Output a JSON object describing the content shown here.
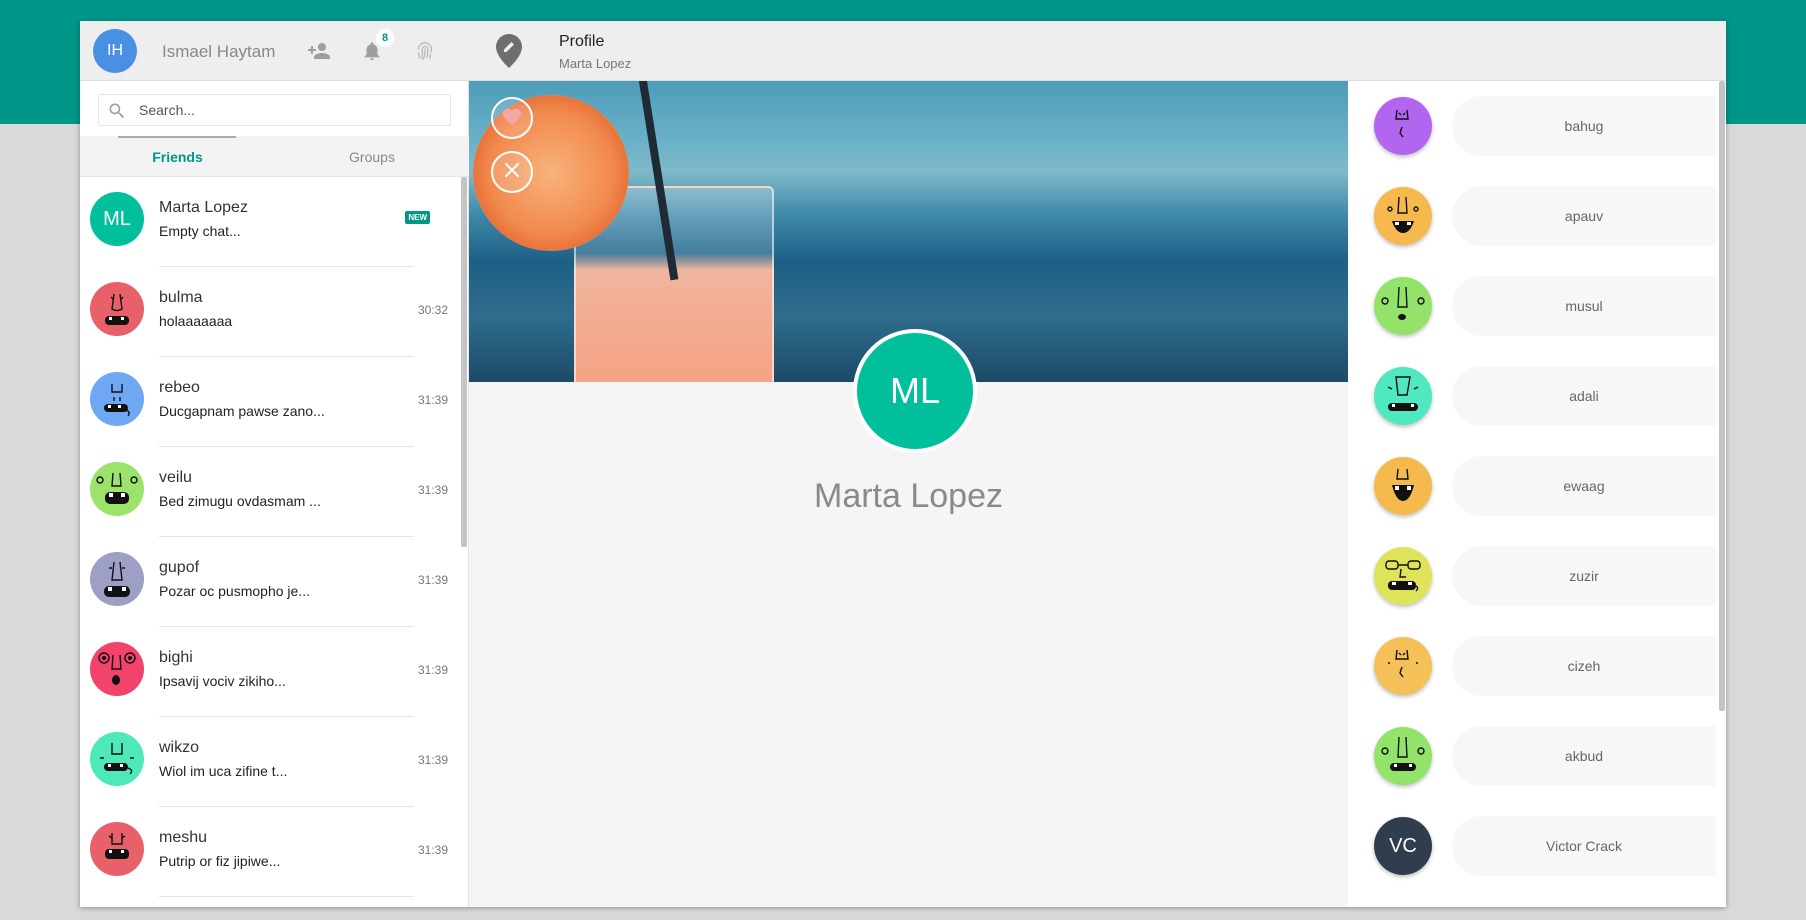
{
  "user": {
    "initials": "IH",
    "name": "Ismael Haytam",
    "notifications": "8"
  },
  "search": {
    "placeholder": "Search..."
  },
  "tabs": [
    {
      "label": "Friends"
    },
    {
      "label": "Groups"
    }
  ],
  "chats": [
    {
      "name": "Marta Lopez",
      "message": "Empty chat...",
      "initials": "ML",
      "time": "",
      "new_badge": "NEW",
      "color": "#00bf9a"
    },
    {
      "name": "bulma",
      "message": "holaaaaaaa",
      "time": "30:32",
      "color": "#e8606a"
    },
    {
      "name": "rebeo",
      "message": "Ducgapnam pawse zano...",
      "time": "31:39",
      "color": "#6fa8f2"
    },
    {
      "name": "veilu",
      "message": "Bed zimugu ovdasmam ...",
      "time": "31:39",
      "color": "#9be36b"
    },
    {
      "name": "gupof",
      "message": "Pozar oc pusmopho je...",
      "time": "31:39",
      "color": "#9d9fc4"
    },
    {
      "name": "bighi",
      "message": "Ipsavij vociv zikiho...",
      "time": "31:39",
      "color": "#f2436b"
    },
    {
      "name": "wikzo",
      "message": "Wiol im uca zifine t...",
      "time": "31:39",
      "color": "#4ee8b9"
    },
    {
      "name": "meshu",
      "message": "Putrip or fiz jipiwe...",
      "time": "31:39",
      "color": "#e8606a"
    }
  ],
  "header": {
    "title": "Profile",
    "subtitle": "Marta Lopez"
  },
  "profile": {
    "initials": "ML",
    "name": "Marta Lopez"
  },
  "members": [
    {
      "name": "bahug",
      "color": "#b266f0"
    },
    {
      "name": "apauv",
      "color": "#f5b94d"
    },
    {
      "name": "musul",
      "color": "#93e36a"
    },
    {
      "name": "adali",
      "color": "#4fe8c0"
    },
    {
      "name": "ewaag",
      "color": "#f5b94d"
    },
    {
      "name": "zuzir",
      "color": "#dfe35a"
    },
    {
      "name": "cizeh",
      "color": "#f5c058"
    },
    {
      "name": "akbud",
      "color": "#93e36a"
    },
    {
      "name": "Victor Crack",
      "initials": "VC",
      "color": "#2f3d4f"
    }
  ]
}
